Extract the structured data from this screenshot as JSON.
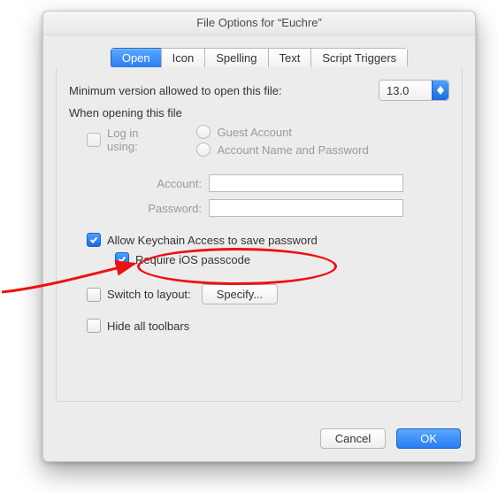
{
  "window": {
    "title": "File Options for “Euchre”"
  },
  "tabs": {
    "open": "Open",
    "icon": "Icon",
    "spelling": "Spelling",
    "text": "Text",
    "script_triggers": "Script Triggers"
  },
  "open_panel": {
    "min_version_label": "Minimum version allowed to open this file:",
    "min_version_value": "13.0",
    "when_opening_label": "When opening this file",
    "login_using": "Log in using:",
    "guest_account": "Guest Account",
    "account_name_password": "Account Name and Password",
    "account_label": "Account:",
    "password_label": "Password:",
    "account_value": "",
    "password_value": "",
    "allow_keychain": "Allow Keychain Access to save password",
    "require_ios_passcode": "Require iOS passcode",
    "switch_to_layout": "Switch to layout:",
    "specify": "Specify...",
    "hide_toolbars": "Hide all toolbars"
  },
  "footer": {
    "cancel": "Cancel",
    "ok": "OK"
  },
  "colors": {
    "accent": "#2a7df2",
    "annotation": "#e11"
  }
}
